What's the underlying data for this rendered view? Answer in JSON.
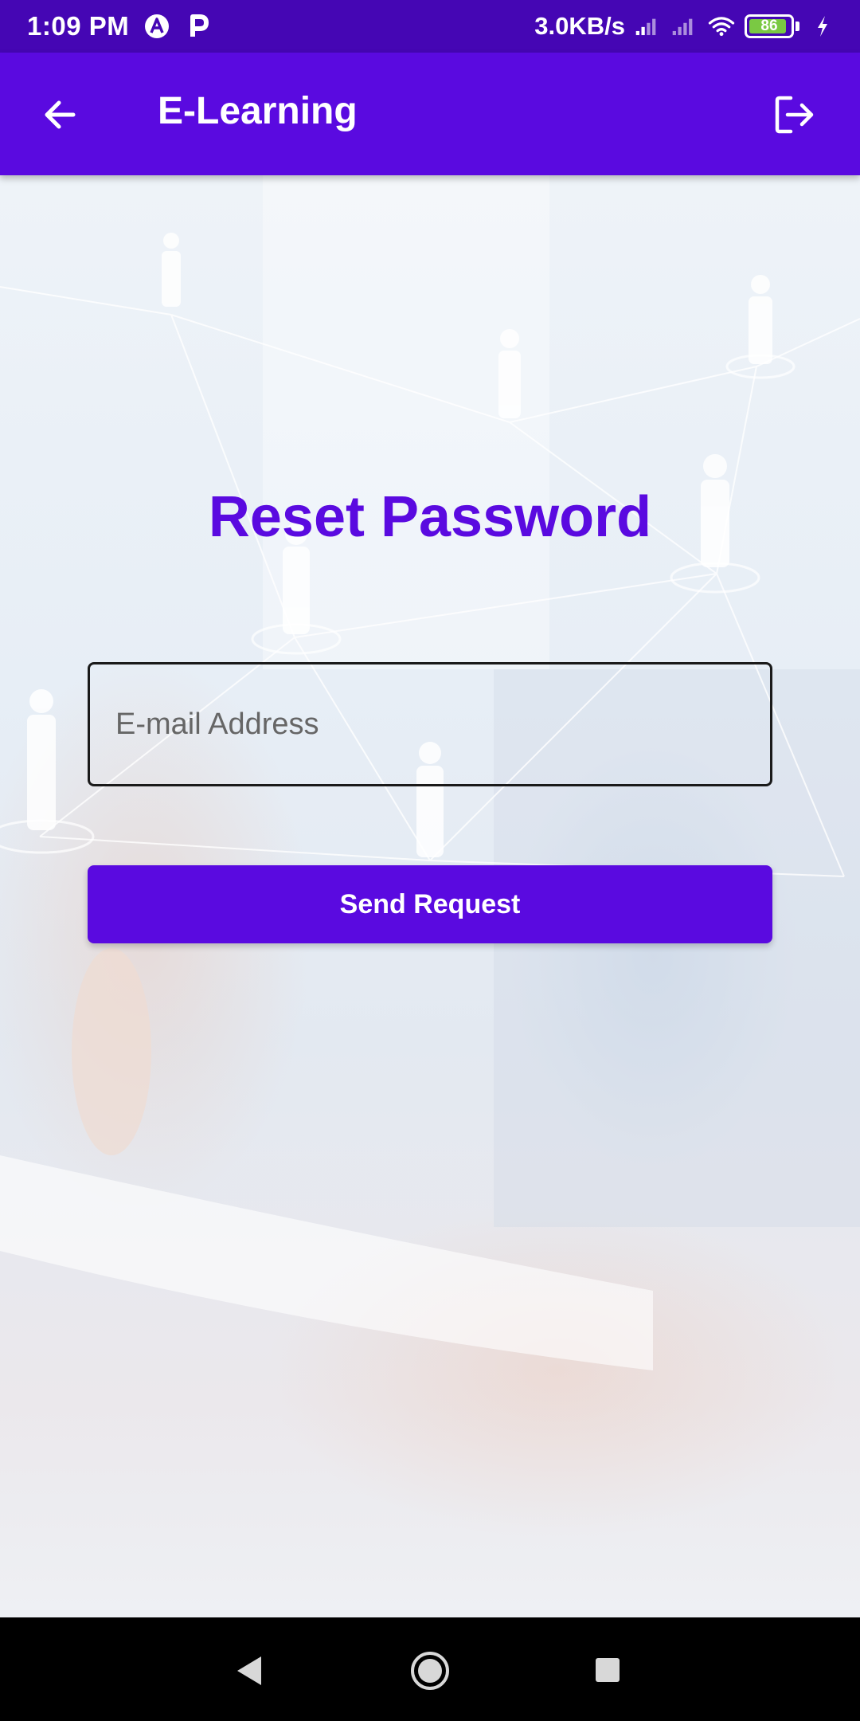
{
  "status_bar": {
    "time": "1:09 PM",
    "net_speed": "3.0KB/s",
    "battery_level": "86",
    "icons": [
      "app-a-icon",
      "parking-p-icon",
      "signal-icon",
      "signal-icon",
      "wifi-icon",
      "battery-icon",
      "charging-icon"
    ]
  },
  "app_bar": {
    "title": "E-Learning",
    "back_icon": "arrow-back-icon",
    "logout_icon": "logout-icon"
  },
  "form": {
    "heading": "Reset Password",
    "email_placeholder": "E-mail Address",
    "email_value": "",
    "submit_label": "Send Request"
  },
  "nav_bar": {
    "icons": [
      "nav-back-icon",
      "nav-home-icon",
      "nav-recents-icon"
    ]
  },
  "colors": {
    "status_bar": "#4506b4",
    "primary": "#5a0ae0",
    "nav_bar": "#000000"
  }
}
